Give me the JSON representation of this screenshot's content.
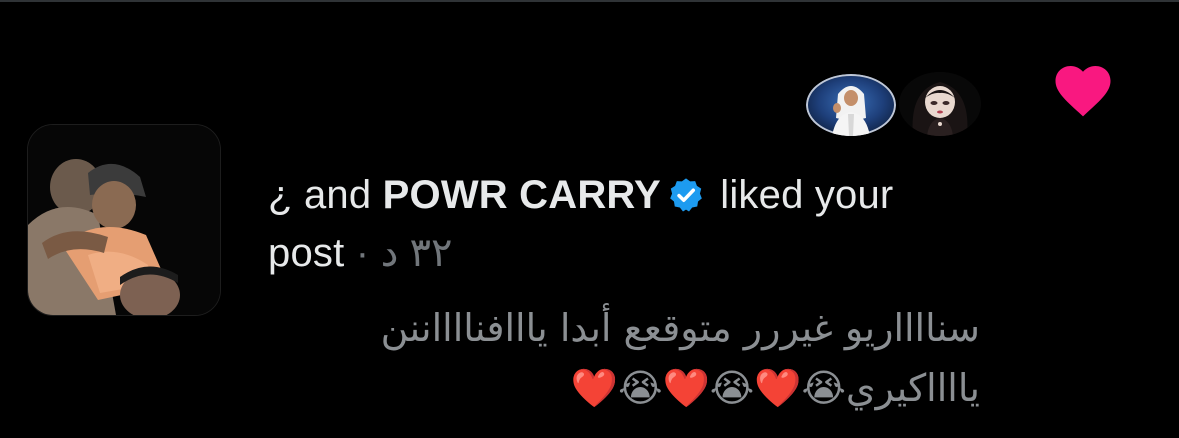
{
  "notification": {
    "actor_prefix": "¿ and",
    "actor_name": "POWR CARRY",
    "action_text": "liked your",
    "object_text": "post",
    "time_separator": "·",
    "time_ago": "٣٢ د",
    "comment_text": "سنااااريو غيررر متوقعع أبدا يااافنااااننن يااااكيري😭❤️😭❤️😭❤️"
  },
  "icons": {
    "like": "heart-icon",
    "verified": "verified-badge-icon"
  },
  "colors": {
    "background": "#000000",
    "heart": "#f91880",
    "verified": "#1d9bf0",
    "primary_text": "#e7e9ea",
    "secondary_text": "#71767b"
  }
}
